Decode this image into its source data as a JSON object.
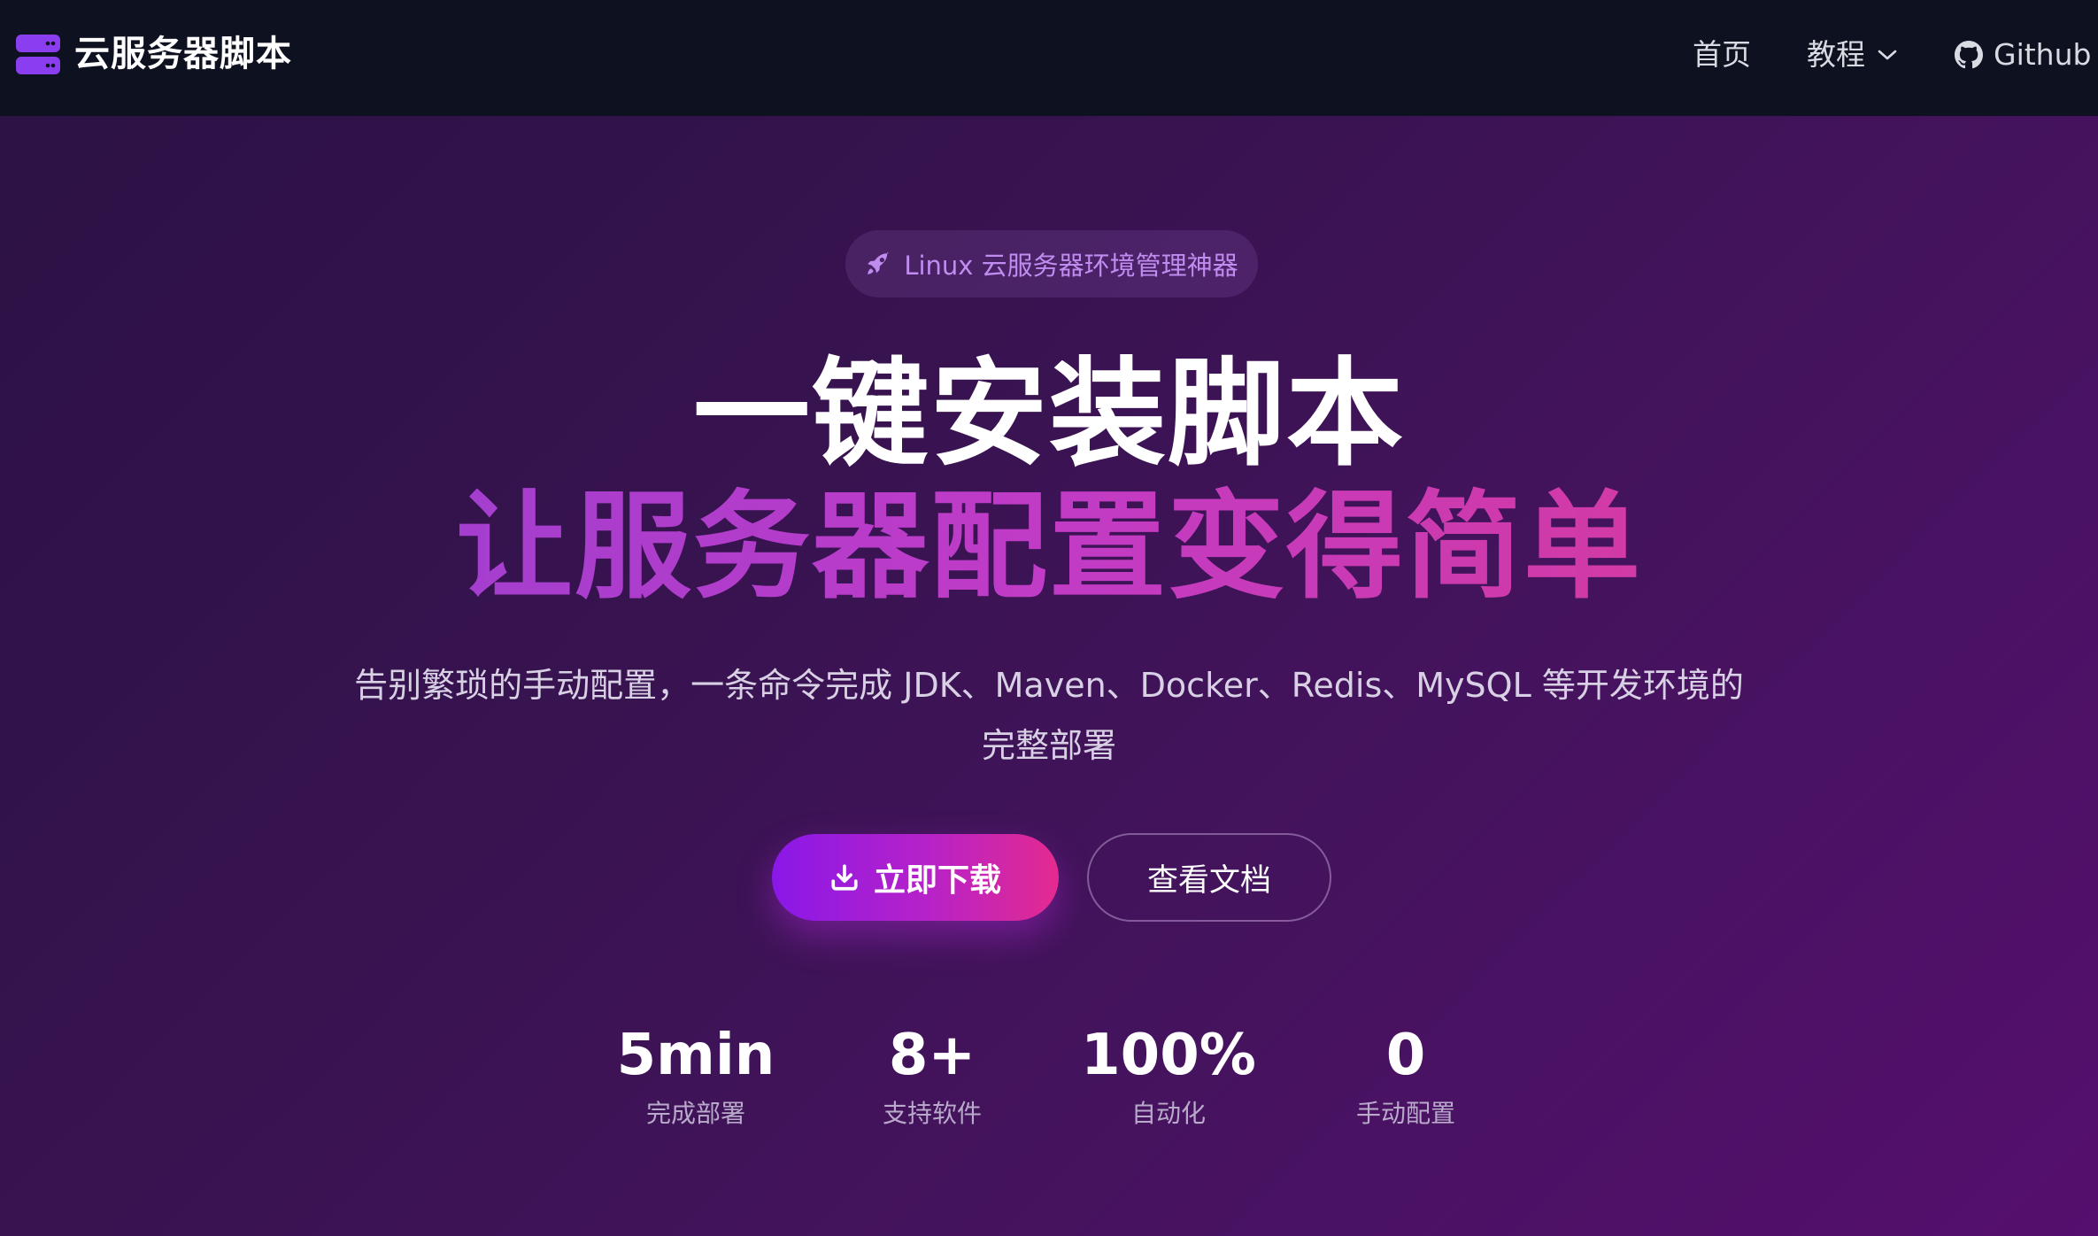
{
  "navbar": {
    "brand": "云服务器脚本",
    "logo_icon": "server-stack-icon",
    "items": [
      {
        "label": "首页"
      },
      {
        "label": "教程",
        "icon": "chevron-down-icon"
      },
      {
        "label": "Github",
        "icon": "github-icon"
      }
    ]
  },
  "hero": {
    "badge": {
      "icon": "rocket-icon",
      "text": "Linux 云服务器环境管理神器"
    },
    "headline_line1": "一键安装脚本",
    "headline_line2": "让服务器配置变得简单",
    "subtitle": "告别繁琐的手动配置，一条命令完成 JDK、Maven、Docker、Redis、MySQL 等开发环境的完整部署",
    "buttons": {
      "download": {
        "label": "立即下载",
        "icon": "download-icon"
      },
      "docs": {
        "label": "查看文档"
      }
    },
    "stats": [
      {
        "value": "5min",
        "label": "完成部署"
      },
      {
        "value": "8+",
        "label": "支持软件"
      },
      {
        "value": "100%",
        "label": "自动化"
      },
      {
        "value": "0",
        "label": "手动配置"
      }
    ]
  },
  "colors": {
    "navbar_bg": "#0d1120",
    "accent_purple": "#8b3df0",
    "gradient_pink": "#e42a8f",
    "headline_gradient": "#b83cd1",
    "badge_text": "#c08cf0"
  }
}
